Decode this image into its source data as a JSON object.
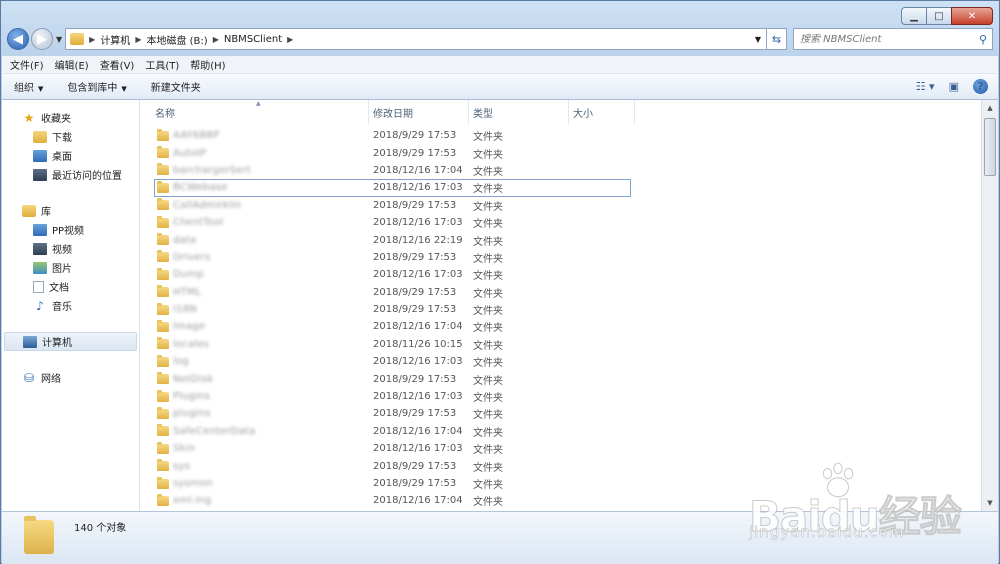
{
  "window": {
    "caption": {
      "minimize": "▁",
      "maximize": "□",
      "close": "✕"
    }
  },
  "address": {
    "segments": [
      "计算机",
      "本地磁盘 (B:)",
      "NBMSClient"
    ],
    "search_placeholder": "搜索 NBMSClient"
  },
  "menubar": [
    "文件(F)",
    "编辑(E)",
    "查看(V)",
    "工具(T)",
    "帮助(H)"
  ],
  "toolbar": {
    "organize": "组织",
    "include_library": "包含到库中",
    "new_folder": "新建文件夹"
  },
  "navpane": {
    "favorites": {
      "label": "收藏夹",
      "items": [
        "下载",
        "桌面",
        "最近访问的位置"
      ]
    },
    "libraries": {
      "label": "库",
      "items": [
        "PP视频",
        "视频",
        "图片",
        "文档",
        "音乐"
      ]
    },
    "computer": "计算机",
    "network": "网络"
  },
  "columns": {
    "name": "名称",
    "date": "修改日期",
    "type": "类型",
    "size": "大小"
  },
  "files": [
    {
      "name": "AAY6B8P",
      "date": "2018/9/29 17:53",
      "type": "文件夹"
    },
    {
      "name": "AutoIP",
      "date": "2018/9/29 17:53",
      "type": "文件夹"
    },
    {
      "name": "barchargerSert",
      "date": "2018/12/16 17:04",
      "type": "文件夹"
    },
    {
      "name": "BCWebase",
      "date": "2018/12/16 17:03",
      "type": "文件夹"
    },
    {
      "name": "CallAdmirklin",
      "date": "2018/9/29 17:53",
      "type": "文件夹"
    },
    {
      "name": "ClientTool",
      "date": "2018/12/16 17:03",
      "type": "文件夹"
    },
    {
      "name": "data",
      "date": "2018/12/16 22:19",
      "type": "文件夹"
    },
    {
      "name": "Drivers",
      "date": "2018/9/29 17:53",
      "type": "文件夹"
    },
    {
      "name": "Dump",
      "date": "2018/12/16 17:03",
      "type": "文件夹"
    },
    {
      "name": "HTML",
      "date": "2018/9/29 17:53",
      "type": "文件夹"
    },
    {
      "name": "I18N",
      "date": "2018/9/29 17:53",
      "type": "文件夹"
    },
    {
      "name": "Image",
      "date": "2018/12/16 17:04",
      "type": "文件夹"
    },
    {
      "name": "locales",
      "date": "2018/11/26 10:15",
      "type": "文件夹"
    },
    {
      "name": "log",
      "date": "2018/12/16 17:03",
      "type": "文件夹"
    },
    {
      "name": "NetDisk",
      "date": "2018/9/29 17:53",
      "type": "文件夹"
    },
    {
      "name": "Plugins",
      "date": "2018/12/16 17:03",
      "type": "文件夹"
    },
    {
      "name": "plugins",
      "date": "2018/9/29 17:53",
      "type": "文件夹"
    },
    {
      "name": "SafeCenterData",
      "date": "2018/12/16 17:04",
      "type": "文件夹"
    },
    {
      "name": "Skin",
      "date": "2018/12/16 17:03",
      "type": "文件夹"
    },
    {
      "name": "sys",
      "date": "2018/9/29 17:53",
      "type": "文件夹"
    },
    {
      "name": "sysmon",
      "date": "2018/9/29 17:53",
      "type": "文件夹"
    },
    {
      "name": "xml.ing",
      "date": "2018/12/16 17:04",
      "type": "文件夹"
    }
  ],
  "selected_index": 3,
  "details": {
    "count": "140 个对象"
  },
  "watermark": {
    "brand": "Baidu经验",
    "url": "jingyan.baidu.com"
  }
}
